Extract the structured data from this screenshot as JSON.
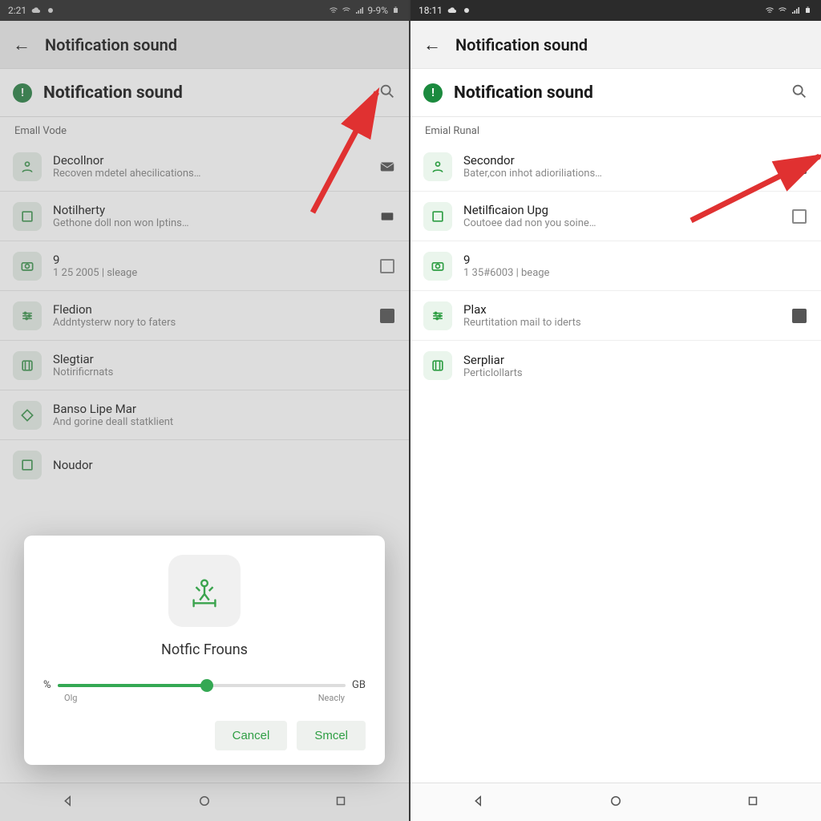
{
  "left": {
    "status": {
      "time": "2:21",
      "battery": "9-9%"
    },
    "header": {
      "title": "Notification sound"
    },
    "subheader": {
      "title": "Notification sound"
    },
    "section": "Emall Vode",
    "rows": [
      {
        "title": "Decollnor",
        "subtitle": "Recoven mdetel ahecilications…",
        "icon": "person",
        "acc": "mail-filled"
      },
      {
        "title": "Notilherty",
        "subtitle": "Gethone doll non won Iptins…",
        "icon": "square",
        "acc": "mail-dark"
      },
      {
        "title": "9",
        "subtitle": "1 25 2005 | sleage",
        "icon": "camera",
        "acc": "chk-empty"
      },
      {
        "title": "Fledion",
        "subtitle": "Addntysterw nory to faters",
        "icon": "sliders",
        "acc": "chk-filled"
      },
      {
        "title": "Slegtiar",
        "subtitle": "Notirificrnats",
        "icon": "frame",
        "acc": ""
      },
      {
        "title": "Banso Lipe Mar",
        "subtitle": "And gorine deall statklient",
        "icon": "diamond",
        "acc": ""
      },
      {
        "title": "Noudor",
        "subtitle": "",
        "icon": "square",
        "acc": ""
      }
    ],
    "dialog": {
      "title": "Notfic Frouns",
      "left_label": "%",
      "right_label": "GB",
      "sub_left": "Olg",
      "sub_right": "Neacly",
      "slider_percent": 52,
      "cancel": "Cancel",
      "confirm": "Smcel"
    }
  },
  "right": {
    "status": {
      "time": "18:11"
    },
    "header": {
      "title": "Notification sound"
    },
    "subheader": {
      "title": "Notification sound"
    },
    "section": "Emial Runal",
    "rows": [
      {
        "title": "Secondor",
        "subtitle": "Bater,con inhot adioriliations…",
        "icon": "person",
        "acc": "chk-filled"
      },
      {
        "title": "Netilficaion Upg",
        "subtitle": "Coutoee dad non you soine…",
        "icon": "square",
        "acc": "chk-empty"
      },
      {
        "title": "9",
        "subtitle": "1 35#6003 | beage",
        "icon": "camera",
        "acc": ""
      },
      {
        "title": "Plax",
        "subtitle": "Reurtitation mail to iderts",
        "icon": "sliders",
        "acc": "chk-filled"
      },
      {
        "title": "Serpliar",
        "subtitle": "Perticlollarts",
        "icon": "frame",
        "acc": ""
      }
    ]
  }
}
